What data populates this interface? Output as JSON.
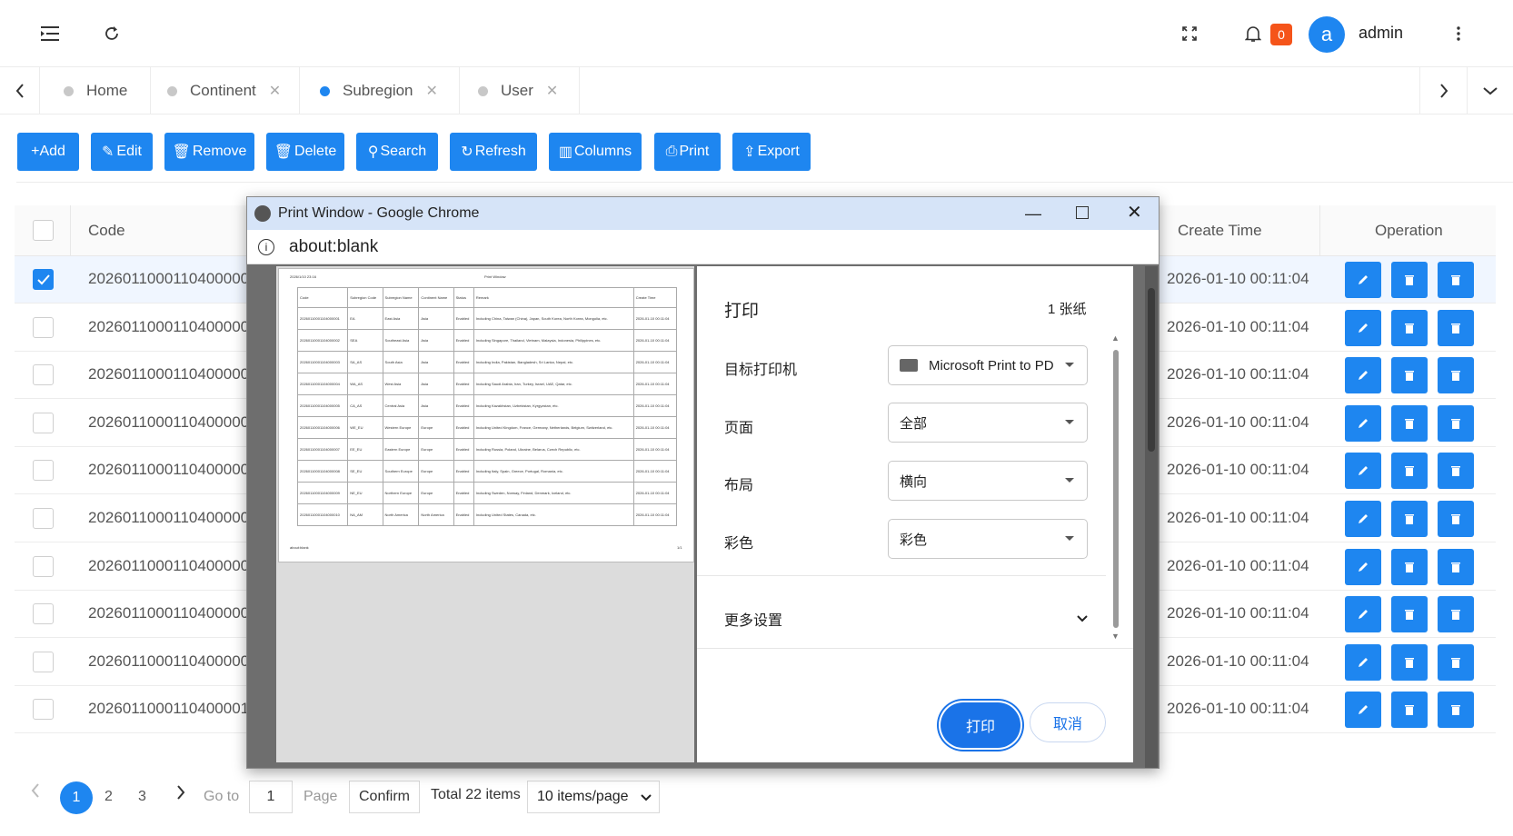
{
  "header": {
    "menu_icon": "menu-fold-icon",
    "refresh_icon": "refresh-icon",
    "fullscreen_icon": "fullscreen-icon",
    "bell_icon": "bell-icon",
    "notification_count": "0",
    "avatar_letter": "a",
    "username": "admin",
    "more_icon": "more-vertical-icon"
  },
  "tabs": [
    {
      "label": "Home",
      "closable": false,
      "active": false
    },
    {
      "label": "Continent",
      "closable": true,
      "active": false
    },
    {
      "label": "Subregion",
      "closable": true,
      "active": true
    },
    {
      "label": "User",
      "closable": true,
      "active": false
    }
  ],
  "toolbar": {
    "add": "+Add",
    "edit": "Edit",
    "remove": "Remove",
    "delete": "Delete",
    "search": "Search",
    "refresh": "Refresh",
    "columns": "Columns",
    "print": "Print",
    "export": "Export"
  },
  "table": {
    "columns": [
      "Code",
      "Create Time",
      "Operation"
    ],
    "rows": [
      {
        "code": "20260110001104000001",
        "create_time": "2026-01-10 00:11:04",
        "selected": true
      },
      {
        "code": "20260110001104000002",
        "create_time": "2026-01-10 00:11:04",
        "selected": false
      },
      {
        "code": "20260110001104000003",
        "create_time": "2026-01-10 00:11:04",
        "selected": false
      },
      {
        "code": "20260110001104000004",
        "create_time": "2026-01-10 00:11:04",
        "selected": false
      },
      {
        "code": "20260110001104000005",
        "create_time": "2026-01-10 00:11:04",
        "selected": false
      },
      {
        "code": "20260110001104000006",
        "create_time": "2026-01-10 00:11:04",
        "selected": false
      },
      {
        "code": "20260110001104000007",
        "create_time": "2026-01-10 00:11:04",
        "selected": false
      },
      {
        "code": "20260110001104000008",
        "create_time": "2026-01-10 00:11:04",
        "selected": false
      },
      {
        "code": "20260110001104000009",
        "create_time": "2026-01-10 00:11:04",
        "selected": false
      },
      {
        "code": "20260110001104000010",
        "create_time": "2026-01-10 00:11:04",
        "selected": false
      }
    ]
  },
  "pagination": {
    "pages": [
      "1",
      "2",
      "3"
    ],
    "current": "1",
    "goto_label": "Go to",
    "goto_value": "1",
    "page_label": "Page",
    "confirm": "Confirm",
    "total": "Total 22 items",
    "page_size": "10 items/page"
  },
  "print_window": {
    "title": "Print Window - Google Chrome",
    "url": "about:blank",
    "heading": "打印",
    "sheets": "1 张纸",
    "printer_label": "目标打印机",
    "printer_value": "Microsoft Print to PD",
    "pages_label": "页面",
    "pages_value": "全部",
    "layout_label": "布局",
    "layout_value": "横向",
    "color_label": "彩色",
    "color_value": "彩色",
    "more_settings": "更多设置",
    "print_button": "打印",
    "cancel_button": "取消",
    "preview": {
      "date": "2026/1/10 23:16",
      "title": "Print Window",
      "footer_left": "about:blank",
      "footer_right": "1/1",
      "headers": [
        "Code",
        "Subregion Code",
        "Subregion Name",
        "Continent Name",
        "Status",
        "Remark",
        "Create Time"
      ],
      "rows": [
        [
          "20260110001104000001",
          "EA",
          "East Asia",
          "Asia",
          "Enabled",
          "Including China, Taiwan (China), Japan, South Korea, North Korea, Mongolia, etc.",
          "2026-01-10 00:11:04"
        ],
        [
          "20260110001104000002",
          "SEA",
          "Southeast Asia",
          "Asia",
          "Enabled",
          "Including Singapore, Thailand, Vietnam, Malaysia, Indonesia, Philippines, etc.",
          "2026-01-10 00:11:04"
        ],
        [
          "20260110001104000003",
          "SA_AS",
          "South Asia",
          "Asia",
          "Enabled",
          "Including India, Pakistan, Bangladesh, Sri Lanka, Nepal, etc.",
          "2026-01-10 00:11:04"
        ],
        [
          "20260110001104000004",
          "WA_AS",
          "West Asia",
          "Asia",
          "Enabled",
          "Including Saudi Arabia, Iran, Turkey, Israel, UAE, Qatar, etc.",
          "2026-01-10 00:11:04"
        ],
        [
          "20260110001104000005",
          "CA_AS",
          "Central Asia",
          "Asia",
          "Enabled",
          "Including Kazakhstan, Uzbekistan, Kyrgyzstan, etc.",
          "2026-01-10 00:11:04"
        ],
        [
          "20260110001104000006",
          "WE_EU",
          "Western Europe",
          "Europe",
          "Enabled",
          "Including United Kingdom, France, Germany, Netherlands, Belgium, Switzerland, etc.",
          "2026-01-10 00:11:04"
        ],
        [
          "20260110001104000007",
          "EE_EU",
          "Eastern Europe",
          "Europe",
          "Enabled",
          "Including Russia, Poland, Ukraine, Belarus, Czech Republic, etc.",
          "2026-01-10 00:11:04"
        ],
        [
          "20260110001104000008",
          "SE_EU",
          "Southern Europe",
          "Europe",
          "Enabled",
          "Including Italy, Spain, Greece, Portugal, Romania, etc.",
          "2026-01-10 00:11:04"
        ],
        [
          "20260110001104000009",
          "NE_EU",
          "Northern Europe",
          "Europe",
          "Enabled",
          "Including Sweden, Norway, Finland, Denmark, Iceland, etc.",
          "2026-01-10 00:11:04"
        ],
        [
          "20260110001104000010",
          "NA_AM",
          "North America",
          "North America",
          "Enabled",
          "Including United States, Canada, etc.",
          "2026-01-10 00:11:04"
        ]
      ]
    }
  },
  "colors": {
    "primary": "#1e86f0",
    "badge": "#f5541a",
    "chrome_title": "#d6e4f8",
    "print_blue": "#1a73e8"
  }
}
